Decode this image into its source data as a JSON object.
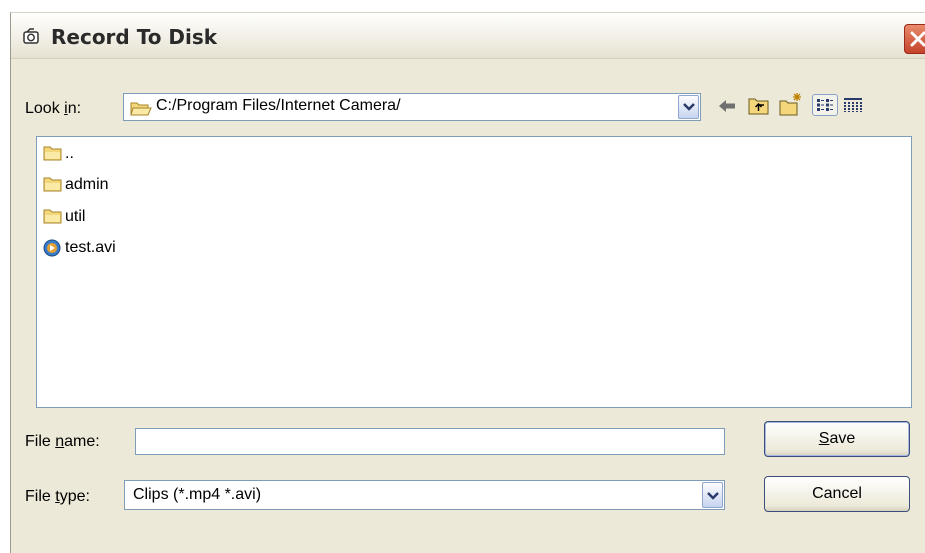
{
  "window": {
    "title": "Record To Disk"
  },
  "look_in": {
    "label_prefix": "Look ",
    "label_accel": "i",
    "label_suffix": "n:",
    "path": "C:/Program Files/Internet Camera/"
  },
  "toolbar": {
    "icons": [
      "back-arrow-icon",
      "up-folder-icon",
      "new-folder-icon",
      "list-view-icon",
      "details-view-icon"
    ]
  },
  "files": [
    {
      "name": "..",
      "icon": "folder-icon"
    },
    {
      "name": "admin",
      "icon": "folder-icon"
    },
    {
      "name": "util",
      "icon": "folder-icon"
    },
    {
      "name": "test.avi",
      "icon": "media-file-icon"
    }
  ],
  "file_name": {
    "label_prefix": "File ",
    "label_accel": "n",
    "label_suffix": "ame:",
    "value": ""
  },
  "file_type": {
    "label_prefix": "File ",
    "label_accel": "t",
    "label_suffix": "ype:",
    "value": "Clips (*.mp4 *.avi)"
  },
  "buttons": {
    "save_accel": "S",
    "save_rest": "ave",
    "cancel": "Cancel"
  },
  "colors": {
    "dialog_bg": "#ece9d8",
    "close_button": "#c4432b",
    "field_border": "#7f9db9"
  }
}
